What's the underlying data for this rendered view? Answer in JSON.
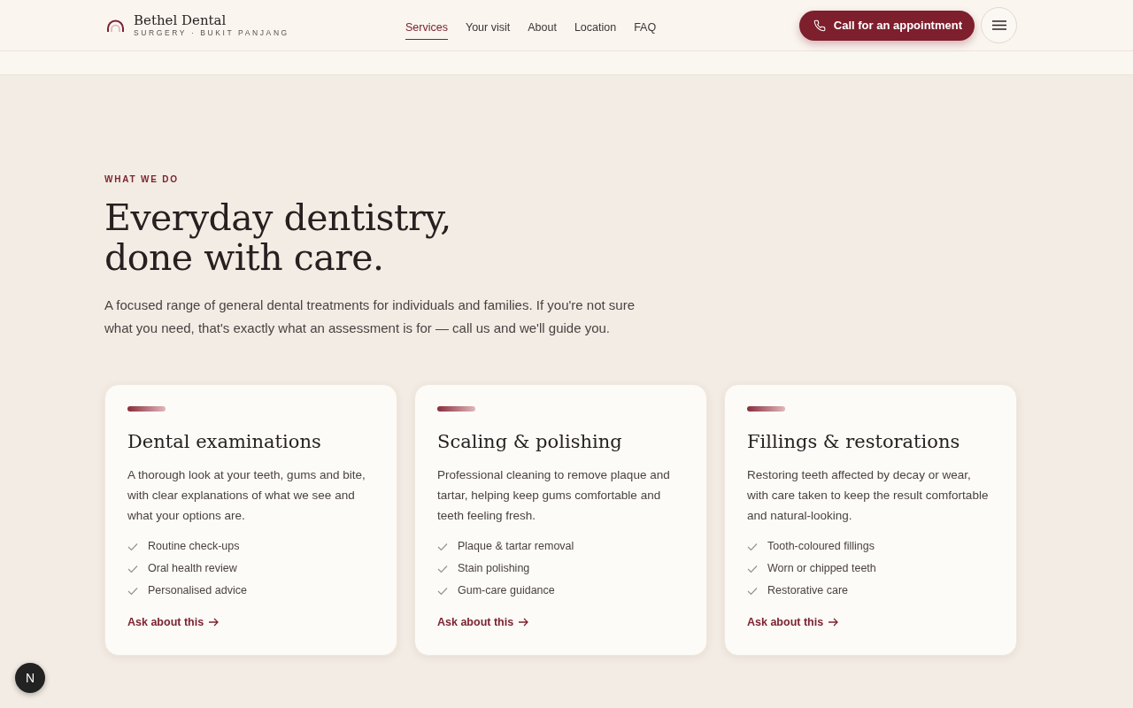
{
  "header": {
    "brand": "Bethel Dental",
    "tagline": "SURGERY · BUKIT PANJANG",
    "nav": [
      {
        "label": "Services",
        "selected": true
      },
      {
        "label": "Your visit",
        "selected": false
      },
      {
        "label": "About",
        "selected": false
      },
      {
        "label": "Location",
        "selected": false
      },
      {
        "label": "FAQ",
        "selected": false
      }
    ],
    "cta": "Call for an appointment"
  },
  "section": {
    "eyebrow": "WHAT WE DO",
    "title_lines": [
      "Everyday dentistry,",
      "done with care."
    ],
    "intro": "A focused range of general dental treatments for individuals and families. If you're not sure what you need, that's exactly what an assessment is for — call us and we'll guide you.",
    "cards": [
      {
        "title": "Dental examinations",
        "text": "A thorough look at your teeth, gums and bite, with clear explanations of what we see and what your options are.",
        "points": [
          "Routine check-ups",
          "Oral health review",
          "Personalised advice"
        ],
        "link": "Ask about this"
      },
      {
        "title": "Scaling & polishing",
        "text": "Professional cleaning to remove plaque and tartar, helping keep gums comfortable and teeth feeling fresh.",
        "points": [
          "Plaque & tartar removal",
          "Stain polishing",
          "Gum-care guidance"
        ],
        "link": "Ask about this"
      },
      {
        "title": "Fillings & restorations",
        "text": "Restoring teeth affected by decay or wear, with care taken to keep the result comfortable and natural-looking.",
        "points": [
          "Tooth-coloured fillings",
          "Worn or chipped teeth",
          "Restorative care"
        ],
        "link": "Ask about this"
      }
    ]
  },
  "dev_badge": "N"
}
